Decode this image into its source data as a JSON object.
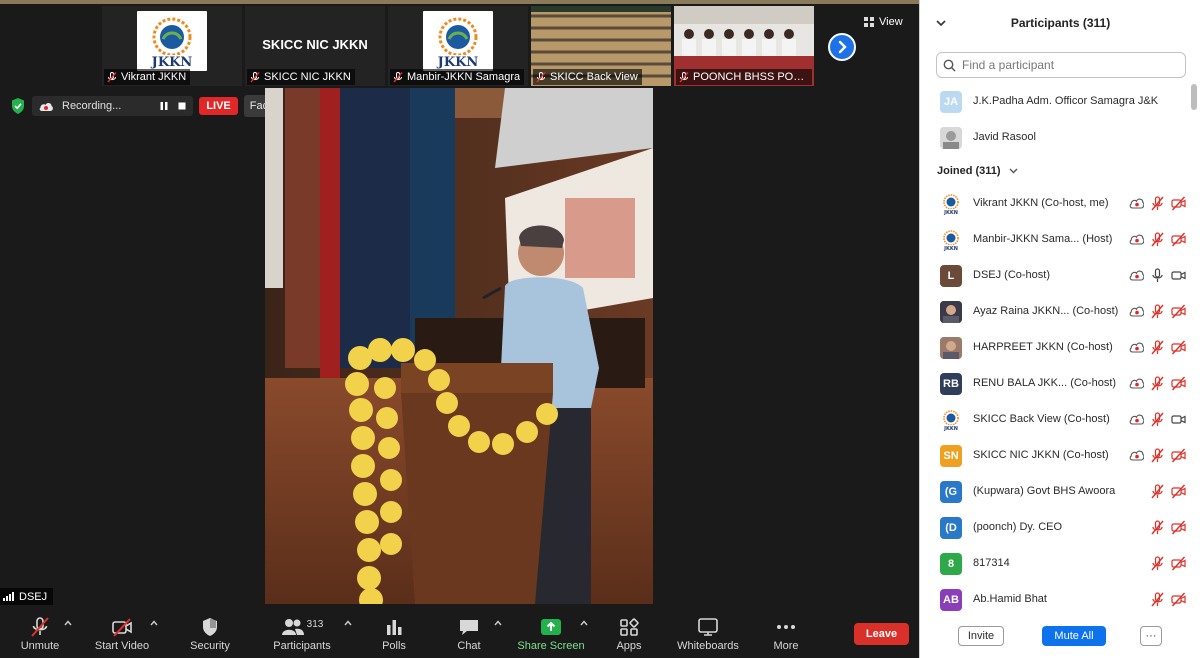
{
  "thumbnails": [
    {
      "name": "Vikrant JKKN",
      "type": "logo"
    },
    {
      "name": "SKICC NIC JKKN",
      "type": "text",
      "big_text": "SKICC NIC JKKN"
    },
    {
      "name": "Manbir-JKKN Samagra",
      "type": "logo"
    },
    {
      "name": "SKICC Back View",
      "type": "photo"
    },
    {
      "name": "POONCH BHSS POO...",
      "type": "photo"
    }
  ],
  "view_label": "View",
  "recording": {
    "label": "Recording...",
    "live_label": "LIVE",
    "stream_label": "Facebook"
  },
  "active_speaker": "DSEJ",
  "toolbar": {
    "unmute": "Unmute",
    "start_video": "Start Video",
    "security": "Security",
    "participants": "Participants",
    "participants_count": "313",
    "polls": "Polls",
    "chat": "Chat",
    "share_screen": "Share Screen",
    "apps": "Apps",
    "whiteboards": "Whiteboards",
    "more": "More",
    "leave": "Leave"
  },
  "panel": {
    "title": "Participants (311)",
    "search_placeholder": "Find a participant",
    "joined_label": "Joined (311)",
    "invite": "Invite",
    "mute_all": "Mute All",
    "more": "···"
  },
  "waiting": [
    {
      "initials": "JA",
      "name": "J.K.Padha Adm. Officor Samagra J&K",
      "color": "#bcd9f2"
    },
    {
      "initials": "",
      "name": "Javid Rasool",
      "color": "#c8c8c8",
      "photo": true
    }
  ],
  "participants": [
    {
      "initials": "",
      "name": "Vikrant JKKN (Co-host, me)",
      "avatar": "logo",
      "mic": "muted",
      "video": "off",
      "rec": true
    },
    {
      "initials": "",
      "name": "Manbir-JKKN Sama...  (Host)",
      "avatar": "logo",
      "mic": "muted",
      "video": "off",
      "rec": true
    },
    {
      "initials": "L",
      "name": "DSEJ (Co-host)",
      "avatar": "letter",
      "color": "#6b4a3a",
      "mic": "on",
      "video": "on",
      "rec": true
    },
    {
      "initials": "",
      "name": "Ayaz Raina JKKN...  (Co-host)",
      "avatar": "photo",
      "color": "#3a3a4a",
      "mic": "muted",
      "video": "off",
      "rec": true
    },
    {
      "initials": "",
      "name": "HARPREET JKKN (Co-host)",
      "avatar": "photo",
      "color": "#9a7a6a",
      "mic": "muted",
      "video": "off",
      "rec": true
    },
    {
      "initials": "RB",
      "name": "RENU BALA JKK...   (Co-host)",
      "avatar": "letter",
      "color": "#2f3f5a",
      "mic": "muted",
      "video": "off",
      "rec": true
    },
    {
      "initials": "",
      "name": "SKICC Back View (Co-host)",
      "avatar": "logo",
      "mic": "muted",
      "video": "on",
      "rec": true
    },
    {
      "initials": "SN",
      "name": "SKICC NIC JKKN (Co-host)",
      "avatar": "letter",
      "color": "#f0a020",
      "mic": "muted",
      "video": "off",
      "rec": true
    },
    {
      "initials": "(G",
      "name": "(Kupwara) Govt BHS Awoora",
      "avatar": "letter",
      "color": "#2a78c8",
      "mic": "muted",
      "video": "off",
      "rec": false
    },
    {
      "initials": "(D",
      "name": "(poonch) Dy. CEO",
      "avatar": "letter",
      "color": "#2a78c8",
      "mic": "muted",
      "video": "off",
      "rec": false
    },
    {
      "initials": "8",
      "name": "817314",
      "avatar": "letter",
      "color": "#2fa84a",
      "mic": "muted",
      "video": "off",
      "rec": false
    },
    {
      "initials": "AB",
      "name": "Ab.Hamid Bhat",
      "avatar": "letter",
      "color": "#8a3fb8",
      "mic": "muted",
      "video": "off",
      "rec": false
    }
  ]
}
